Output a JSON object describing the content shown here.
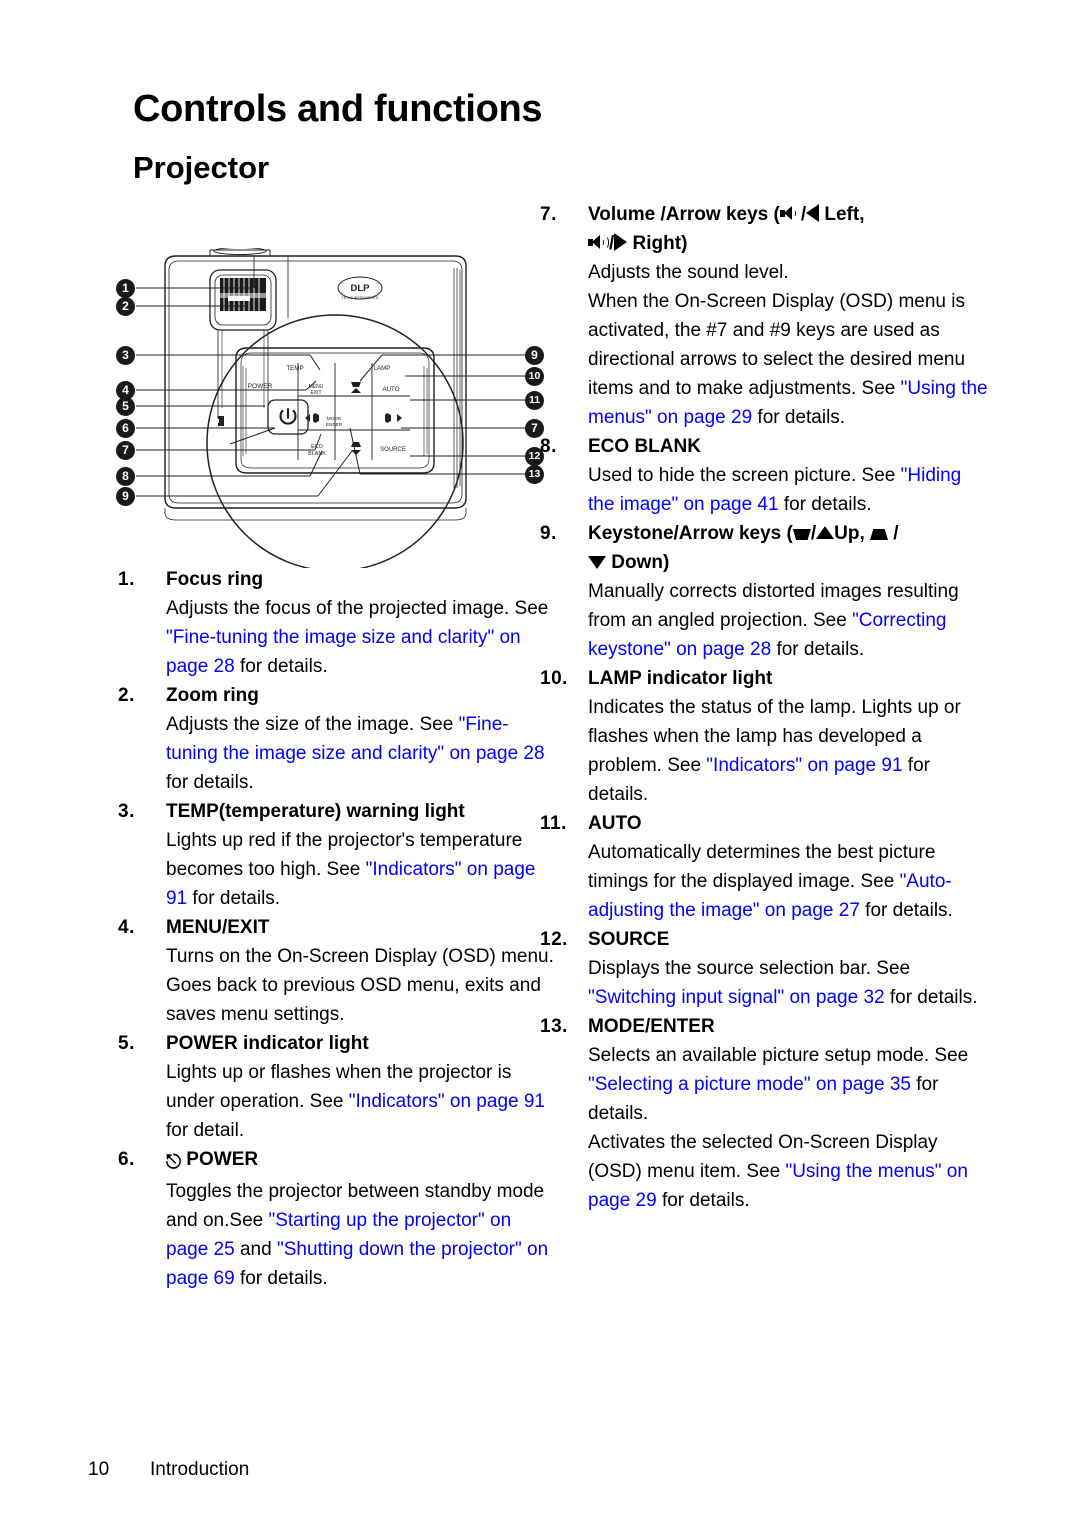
{
  "heading": {
    "title": "Controls and functions",
    "subtitle": "Projector"
  },
  "footer": {
    "page_number": "10",
    "section": "Introduction"
  },
  "colors": {
    "link": "#0000ff",
    "text": "#000000",
    "callout_bg": "#1a1a1a"
  },
  "figure": {
    "alt_name": "projector-top-view",
    "brand_logo": "DLP",
    "brand_logo_sub": "TEXAS INSTRUMENTS",
    "panel_labels": {
      "temp": "TEMP",
      "lamp": "LAMP",
      "power": "POWER",
      "menu_exit": "MENU EXIT",
      "auto": "AUTO",
      "mode_enter": "MODE ENTER",
      "eco_blank": "ECO BLANK",
      "source": "SOURCE"
    },
    "left_callouts": [
      "1",
      "2",
      "3",
      "4",
      "5",
      "6",
      "7",
      "8",
      "9"
    ],
    "right_callouts": [
      "9",
      "10",
      "11",
      "7",
      "12",
      "13"
    ]
  },
  "items_left": [
    {
      "num": "1.",
      "title": "Focus ring",
      "desc_html": "Adjusts the focus of the projected image. See <span class=\"lnk\">\"Fine-tuning the image size and clarity\" on page 28</span> for details."
    },
    {
      "num": "2.",
      "title": "Zoom ring",
      "desc_html": "Adjusts the size of the image. See <span class=\"lnk\">\"Fine-tuning the image size and clarity\" on page 28</span> for details."
    },
    {
      "num": "3.",
      "title": "TEMP(temperature) warning light",
      "desc_html": "Lights up red if the projector's temperature becomes too high. See <span class=\"lnk\">\"Indicators\" on page 91</span> for details."
    },
    {
      "num": "4.",
      "title": "MENU/EXIT",
      "desc_html": "Turns on the On-Screen Display (OSD) menu. Goes back to previous OSD menu, exits and saves menu settings."
    },
    {
      "num": "5.",
      "title": "POWER indicator light",
      "desc_html": "Lights up or flashes when the projector is under operation. See <span class=\"lnk\">\"Indicators\" on page 91</span> for detail."
    },
    {
      "num": "6.",
      "title_html": "<span class=\"pwr-glyph\">&#9099;</span> POWER",
      "title": "POWER",
      "desc_html": "Toggles the projector between standby mode and on.See <span class=\"lnk\">\"Starting up the projector\" on page 25</span> and <span class=\"lnk\">\"Shutting down the projector\" on page 69</span> for details."
    }
  ],
  "items_right": [
    {
      "num": "7.",
      "title_html": "Volume /Arrow keys (<span class=\"ic spk\"><span class=\"body\"></span><span class=\"cone\"></span><span class=\"w1\"></span></span>/<span class=\"ic tri-l\"></span> Left,<br><span class=\"ic spk\"><span class=\"body\"></span><span class=\"cone\"></span><span class=\"w1\"></span><span class=\"w2\"></span></span>/<span class=\"ic tri-r\"></span> Right)",
      "title": "Volume /Arrow keys ( Left, Right)",
      "desc_html": "Adjusts the sound level.<br>When the On-Screen Display (OSD) menu is activated, the #7 and #9 keys are used as directional arrows to select the desired menu items and to make adjustments. See <span class=\"lnk\">\"Using the menus\" on page 29</span> for details."
    },
    {
      "num": "8.",
      "title": "ECO BLANK",
      "desc_html": "Used to hide the screen picture. See <span class=\"lnk\">\"Hiding the image\" on page 41</span> for details."
    },
    {
      "num": "9.",
      "title_html": "Keystone/Arrow keys (<span class=\"ic trap-dn\"></span>/<span class=\"ic tri-u\"></span>Up, <span class=\"ic trap-up\"></span> /<br><span class=\"ic tri-d\"></span> Down)",
      "title": "Keystone/Arrow keys ( Up, Down)",
      "desc_html": "Manually corrects distorted images resulting from an angled projection. See <span class=\"lnk\">\"Correcting keystone\" on page 28</span> for details."
    },
    {
      "num": "10.",
      "title": "LAMP indicator light",
      "desc_html": "Indicates the status of the lamp. Lights up or flashes when the lamp has developed a problem. See <span class=\"lnk\">\"Indicators\" on page 91</span> for details."
    },
    {
      "num": "11.",
      "title": "AUTO",
      "desc_html": "Automatically determines the best picture timings for the displayed image. See <span class=\"lnk\">\"Auto-adjusting the image\" on page 27</span> for details."
    },
    {
      "num": "12.",
      "title": "SOURCE",
      "desc_html": "Displays the source selection bar. See <span class=\"lnk\">\"Switching input signal\" on page 32</span> for details."
    },
    {
      "num": "13.",
      "title": "MODE/ENTER",
      "desc_html": "Selects an available picture setup mode. See <span class=\"lnk\">\"Selecting a picture mode\" on page 35</span> for details.<br>Activates the selected On-Screen Display (OSD) menu item. See <span class=\"lnk\">\"Using the menus\" on page 29</span> for details."
    }
  ]
}
